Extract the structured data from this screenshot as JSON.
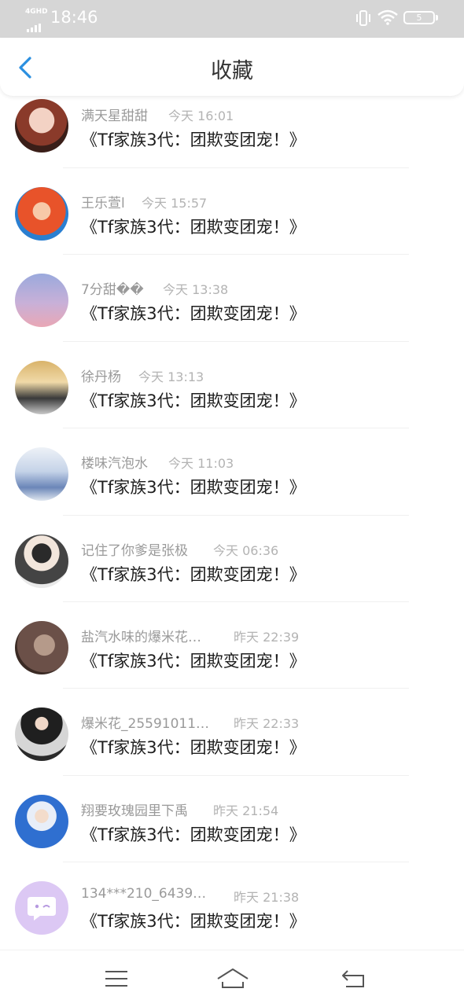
{
  "status_bar": {
    "network": "4GHD",
    "time": "18:46",
    "battery": "5"
  },
  "header": {
    "title": "收藏",
    "back_icon": "chevron-left-icon"
  },
  "items": [
    {
      "username": "满天星甜甜",
      "time": "今天 16:01",
      "content": "《Tf家族3代：团欺变团宠！》",
      "avatar_color": "#d9a08a"
    },
    {
      "username": "王乐萱l",
      "time": "今天 15:57",
      "content": "《Tf家族3代：团欺变团宠！》",
      "avatar_color": "#e06a2a"
    },
    {
      "username": "7分甜��",
      "time": "今天 13:38",
      "content": "《Tf家族3代：团欺变团宠！》",
      "avatar_color": "#a9b6e0"
    },
    {
      "username": "徐丹杨",
      "time": "今天 13:13",
      "content": "《Tf家族3代：团欺变团宠！》",
      "avatar_color": "#c9a86a"
    },
    {
      "username": "楼味汽泡水",
      "time": "今天 11:03",
      "content": "《Tf家族3代：团欺变团宠！》",
      "avatar_color": "#cfd8e6"
    },
    {
      "username": "记住了你爹是张极",
      "time": "今天 06:36",
      "content": "《Tf家族3代：团欺变团宠！》",
      "avatar_color": "#5a5a5a"
    },
    {
      "username": "盐汽水味的爆米花…",
      "time": "昨天 22:39",
      "content": "《Tf家族3代：团欺变团宠！》",
      "avatar_color": "#6b5048"
    },
    {
      "username": "爆米花_25591011…",
      "time": "昨天 22:33",
      "content": "《Tf家族3代：团欺变团宠！》",
      "avatar_color": "#4a4a4a"
    },
    {
      "username": "翔要玫瑰园里下禹",
      "time": "昨天 21:54",
      "content": "《Tf家族3代：团欺变团宠！》",
      "avatar_color": "#2f6fd0"
    },
    {
      "username": "134***210_6439…",
      "time": "昨天 21:38",
      "content": "《Tf家族3代：团欺变团宠！》",
      "avatar_color": "#d9c4f2"
    }
  ],
  "nav": {
    "menu_icon": "menu-icon",
    "home_icon": "home-icon",
    "back_icon": "back-icon"
  }
}
